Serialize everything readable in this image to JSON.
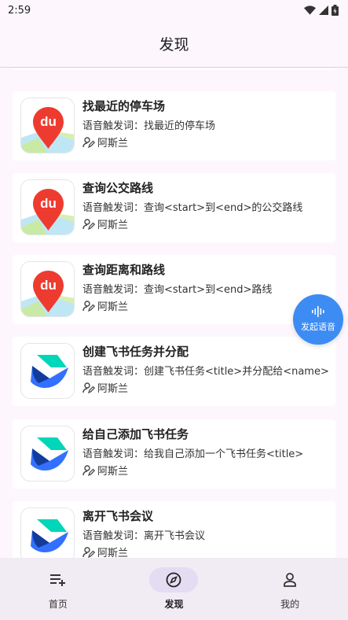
{
  "status_bar": {
    "time": "2:59"
  },
  "app_bar": {
    "title": "发现"
  },
  "cards": [
    {
      "title": "找最近的停车场",
      "trigger": "语音触发词：找最近的停车场",
      "author": "阿斯兰",
      "icon": "baidu-map-icon"
    },
    {
      "title": "查询公交路线",
      "trigger": "语音触发词：查询<start>到<end>的公交路线",
      "author": "阿斯兰",
      "icon": "baidu-map-icon"
    },
    {
      "title": "查询距离和路线",
      "trigger": "语音触发词：查询<start>到<end>路线",
      "author": "阿斯兰",
      "icon": "baidu-map-icon"
    },
    {
      "title": "创建飞书任务并分配",
      "trigger": "语音触发词：创建飞书任务<title>并分配给<name>",
      "author": "阿斯兰",
      "icon": "feishu-icon"
    },
    {
      "title": "给自己添加飞书任务",
      "trigger": "语音触发词：给我自己添加一个飞书任务<title>",
      "author": "阿斯兰",
      "icon": "feishu-icon"
    },
    {
      "title": "离开飞书会议",
      "trigger": "语音触发词：离开飞书会议",
      "author": "阿斯兰",
      "icon": "feishu-icon"
    }
  ],
  "fab": {
    "label": "发起语音"
  },
  "nav": [
    {
      "label": "首页",
      "icon": "playlist-add-icon",
      "active": false
    },
    {
      "label": "发现",
      "icon": "compass-icon",
      "active": true
    },
    {
      "label": "我的",
      "icon": "person-icon",
      "active": false
    }
  ],
  "colors": {
    "accent": "#3c8cf4",
    "nav_active_pill": "#e4dcf2",
    "baidu_red": "#ee3b2f",
    "feishu_blue": "#3370ff",
    "feishu_teal": "#00d6b9"
  }
}
